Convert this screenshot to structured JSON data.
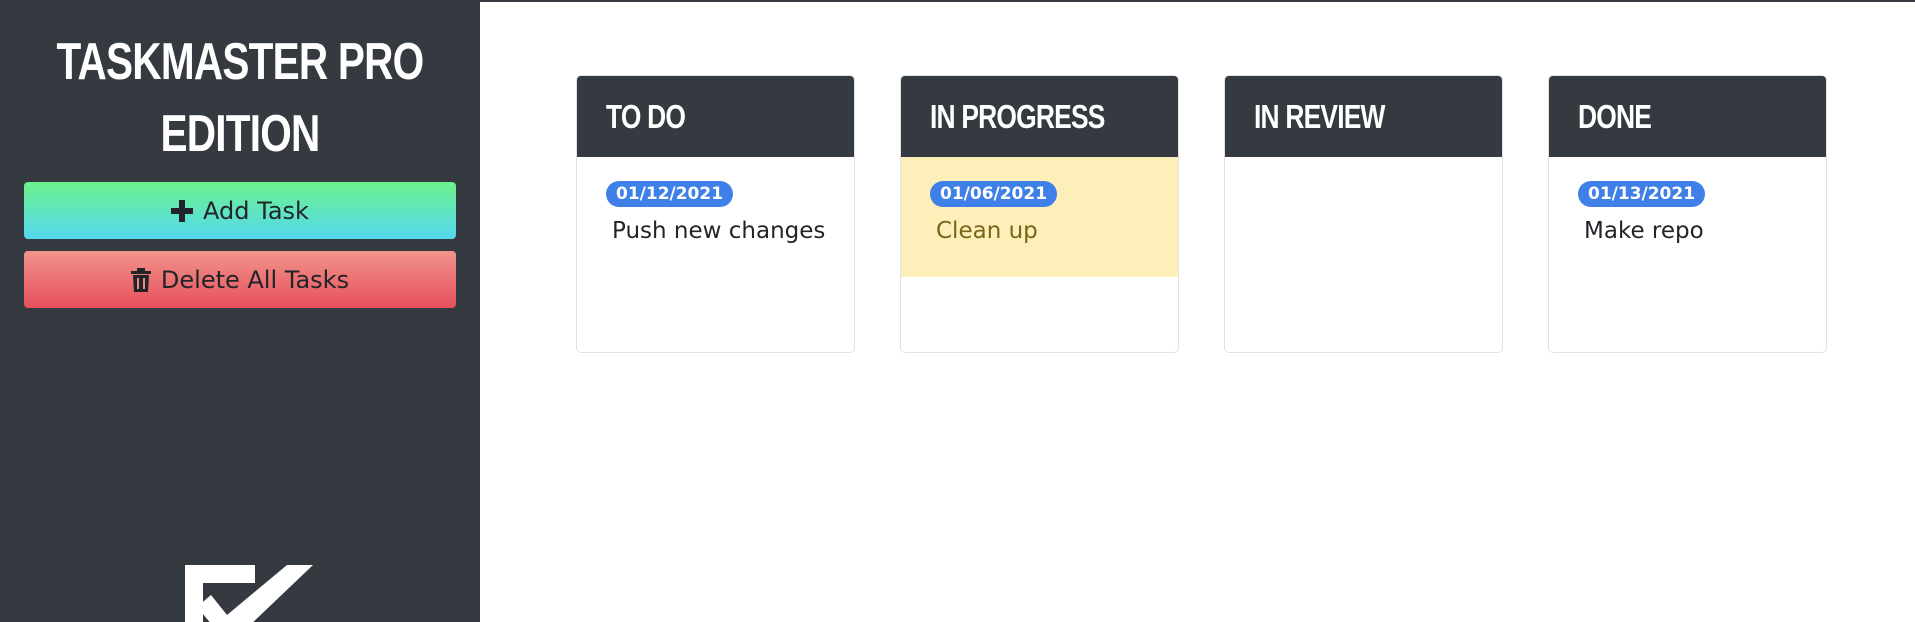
{
  "app": {
    "title": "TASKMASTER PRO EDITION"
  },
  "sidebar": {
    "add_label": "Add Task",
    "delete_label": "Delete All Tasks",
    "add_icon": "plus-icon",
    "delete_icon": "trash-icon",
    "logo_icon": "checkbox-logo-icon"
  },
  "columns": [
    {
      "title": "TO DO",
      "tasks": [
        {
          "date": "01/12/2021",
          "text": "Push new changes"
        }
      ]
    },
    {
      "title": "IN PROGRESS",
      "tasks": [
        {
          "date": "01/06/2021",
          "text": "Clean up",
          "highlighted": true
        }
      ]
    },
    {
      "title": "IN REVIEW",
      "tasks": []
    },
    {
      "title": "DONE",
      "tasks": [
        {
          "date": "01/13/2021",
          "text": "Make repo"
        }
      ]
    }
  ],
  "colors": {
    "sidebar": "#343a40",
    "badge": "#3f7fe8",
    "highlight": "#fcefba"
  }
}
